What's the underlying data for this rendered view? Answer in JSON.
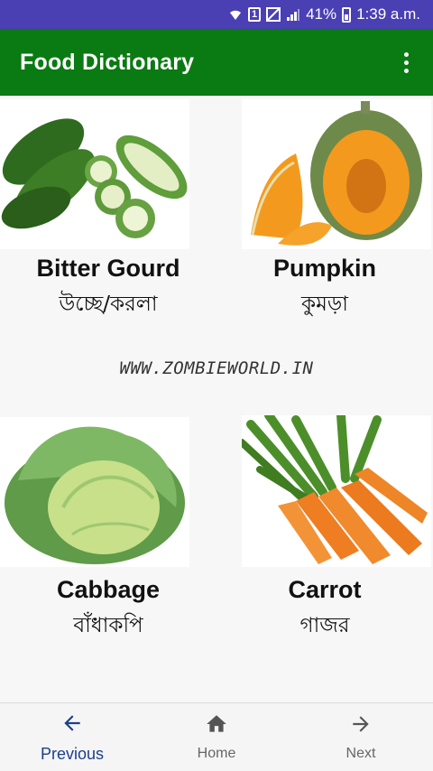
{
  "status_bar": {
    "sim_label": "1",
    "battery_percent": "41%",
    "time": "1:39 a.m."
  },
  "app_bar": {
    "title": "Food Dictionary"
  },
  "items": [
    {
      "english": "Bitter Gourd",
      "bengali": "উচ্ছে/করলা"
    },
    {
      "english": "Pumpkin",
      "bengali": "কুমড়া"
    },
    {
      "english": "Cabbage",
      "bengali": "বাঁধাকপি"
    },
    {
      "english": "Carrot",
      "bengali": "গাজর"
    }
  ],
  "watermark": "WWW.ZOMBIEWORLD.IN",
  "bottom_nav": {
    "previous": "Previous",
    "home": "Home",
    "next": "Next"
  },
  "colors": {
    "status_bar": "#4a3fb3",
    "app_bar": "#0a7a12",
    "nav_active": "#1d3f8a"
  }
}
